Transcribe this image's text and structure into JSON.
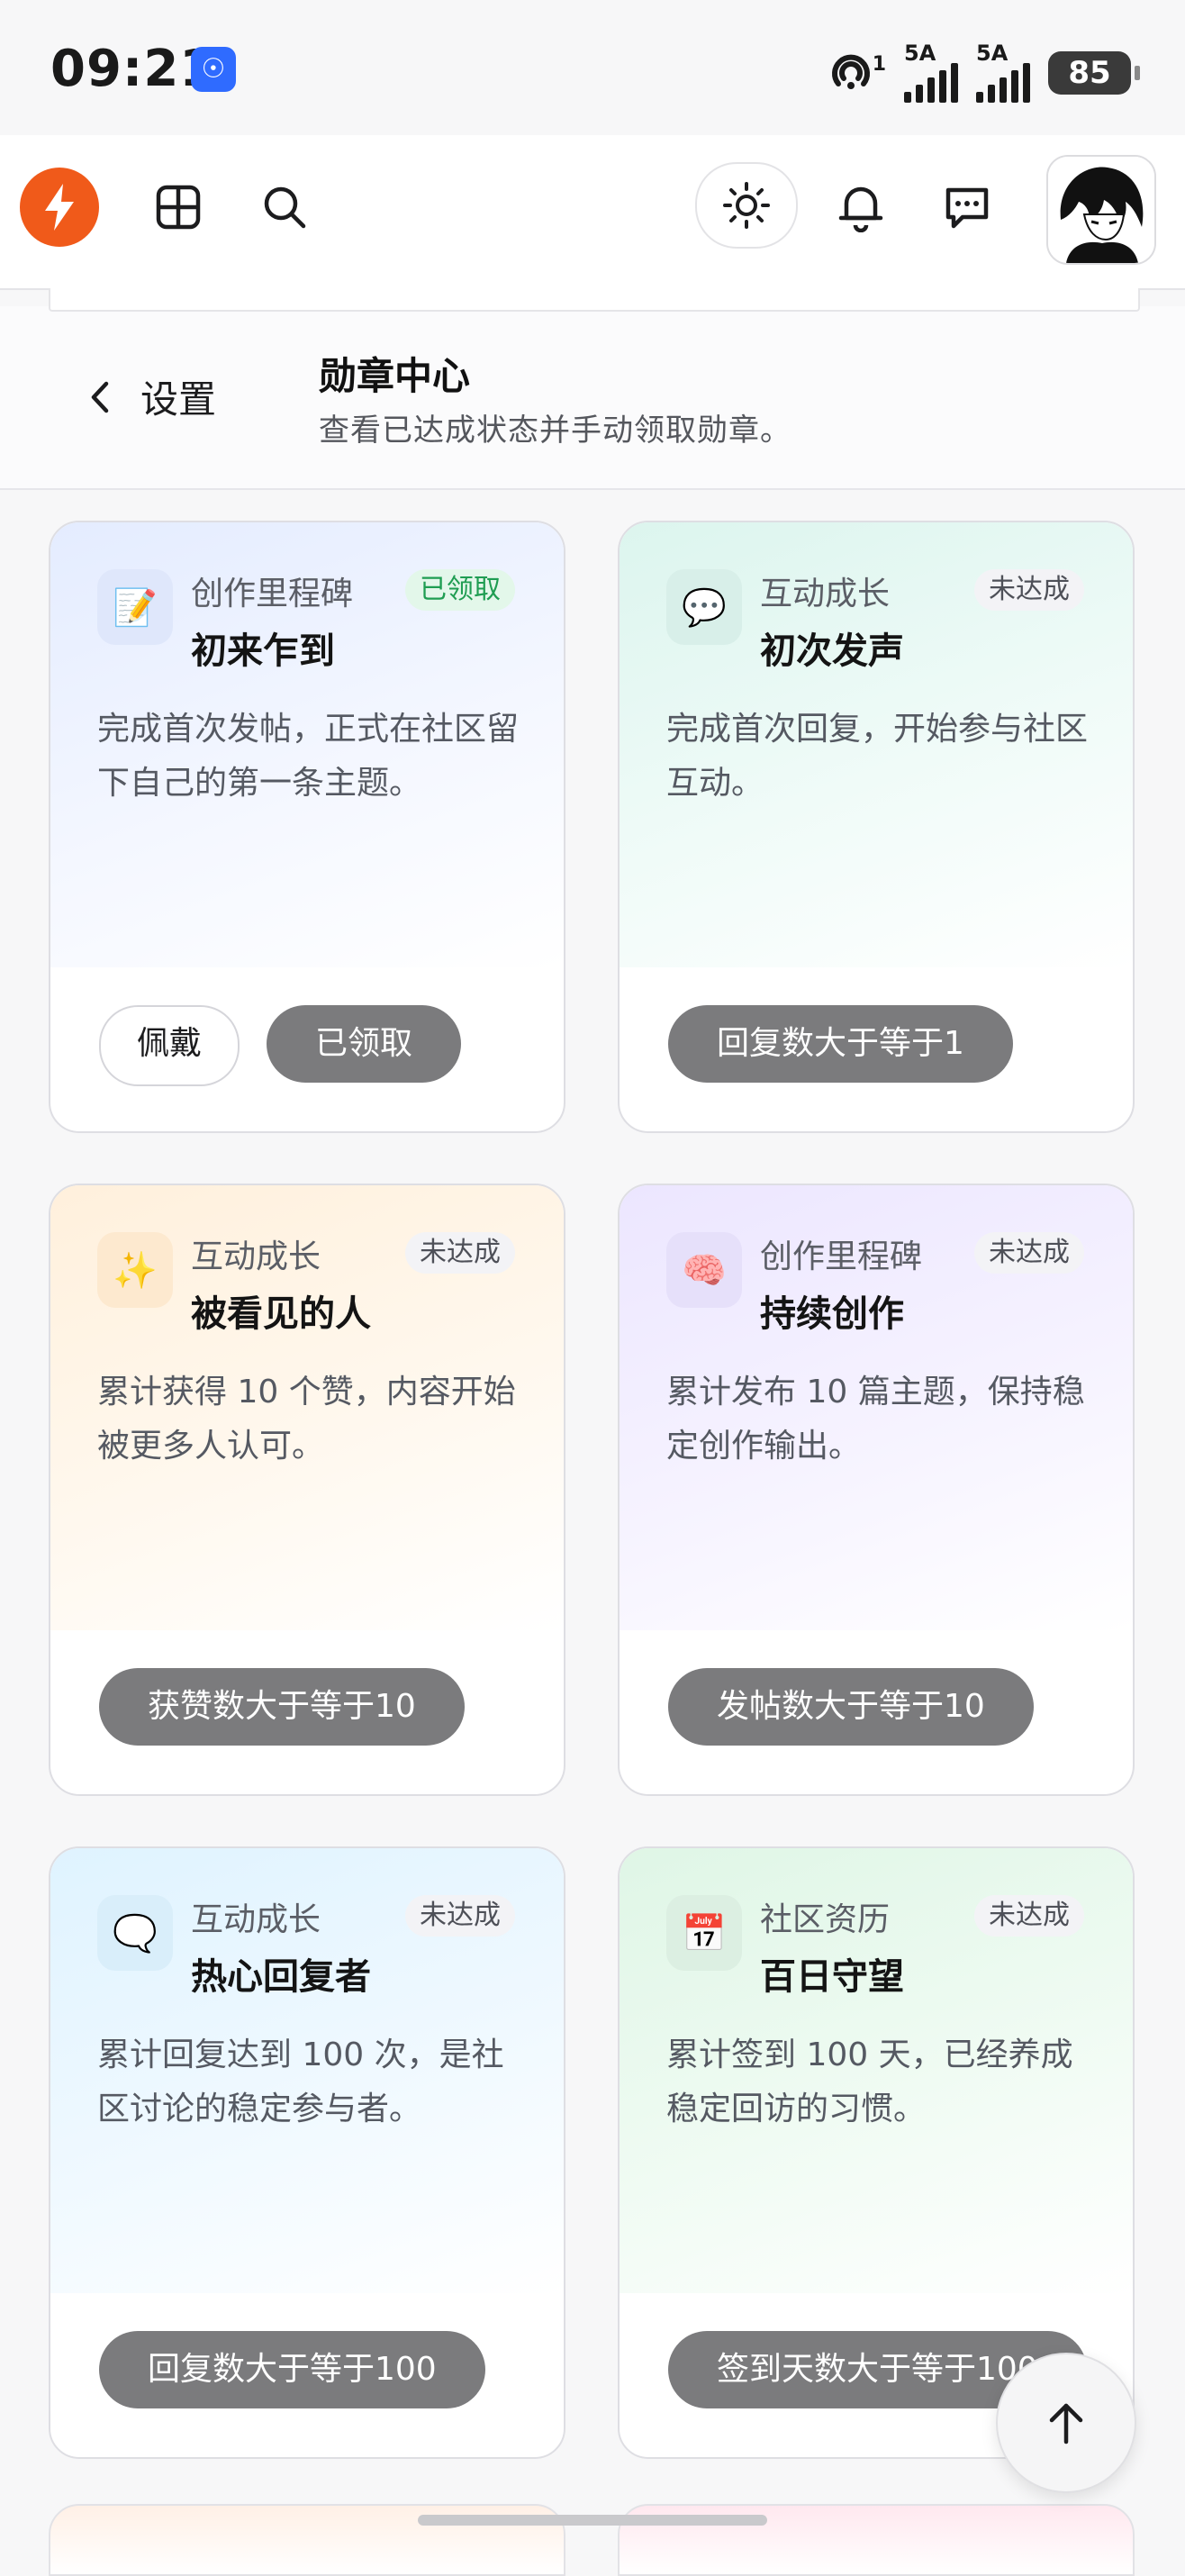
{
  "status_bar": {
    "time": "09:21",
    "hotspot_sup": "1",
    "sim1_label": "5A",
    "sim2_label": "5A",
    "battery": "85"
  },
  "page": {
    "back_label": "设置",
    "title": "勋章中心",
    "subtitle": "查看已达成状态并手动领取勋章。"
  },
  "cards": [
    {
      "icon": "📝",
      "category": "创作里程碑",
      "name": "初来乍到",
      "status": "已领取",
      "desc": "完成首次发帖，正式在社区留下自己的第一条主题。",
      "wear_label": "佩戴",
      "action": "已领取"
    },
    {
      "icon": "💬",
      "category": "互动成长",
      "name": "初次发声",
      "status": "未达成",
      "desc": "完成首次回复，开始参与社区互动。",
      "action": "回复数大于等于1"
    },
    {
      "icon": "✨",
      "category": "互动成长",
      "name": "被看见的人",
      "status": "未达成",
      "desc": "累计获得 10 个赞，内容开始被更多人认可。",
      "action": "获赞数大于等于10"
    },
    {
      "icon": "🧠",
      "category": "创作里程碑",
      "name": "持续创作",
      "status": "未达成",
      "desc": "累计发布 10 篇主题，保持稳定创作输出。",
      "action": "发帖数大于等于10"
    },
    {
      "icon": "🗨️",
      "category": "互动成长",
      "name": "热心回复者",
      "status": "未达成",
      "desc": "累计回复达到 100 次，是社区讨论的稳定参与者。",
      "action": "回复数大于等于100"
    },
    {
      "icon": "📅",
      "category": "社区资历",
      "name": "百日守望",
      "status": "未达成",
      "desc": "累计签到 100 天，已经养成稳定回访的习惯。",
      "action": "签到天数大于等于100"
    }
  ]
}
